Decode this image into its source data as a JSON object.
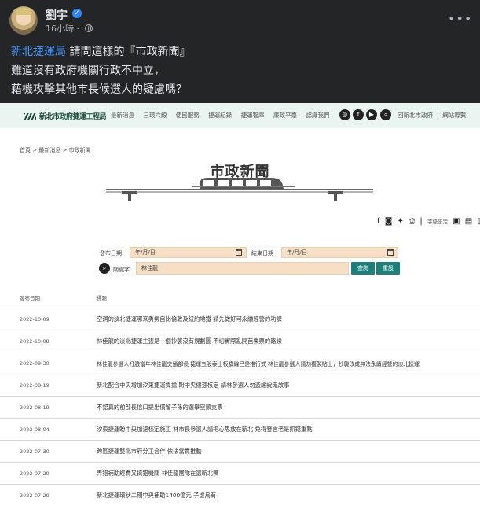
{
  "post": {
    "author": "劉宇",
    "time": "16小時",
    "mention": "新北捷運局",
    "line1_rest": " 請問這樣的『市政新聞』",
    "line2": "難道沒有政府機關行政不中立，",
    "line3": "藉機攻擊其他市長候選人的疑慮嗎？"
  },
  "site": {
    "logo_text": "新北市政府捷運工程局",
    "nav_items": [
      "最新消息",
      "三環六線",
      "便民服務",
      "捷運紀錄",
      "捷運智庫",
      "廉政平臺",
      "認識我們"
    ],
    "nav_right": "回新北市政府 ｜ 網站導覽",
    "breadcrumb": "首頁  >  最新消息  >  市政新聞",
    "page_title": "市政新聞",
    "font_setting_label": "字級設定"
  },
  "filter": {
    "date_label": "發布日期",
    "end_date_label": "結束日期",
    "date_placeholder": "年/月/日",
    "keyword_label": "關鍵字",
    "keyword_value": "林佳龍",
    "search_button": "查詢",
    "reset_button": "重設"
  },
  "table": {
    "headers": {
      "date": "發布日期",
      "title": "標題"
    },
    "rows": [
      {
        "date": "2022-10-09",
        "title": "空洞的淡北捷運哪來勇氣自比倫敦及紐約地鐵 請先做好可永續經營的功課"
      },
      {
        "date": "2022-10-08",
        "title": "林佳龍的淡北捷運主張是一個抄襲沒有規劃圖 不切實際亂開芭樂票的路線"
      },
      {
        "date": "2022-09-30",
        "title": "林佳龍參選人打臉當年林佳龍交通部長 捷運五股泰山板橋線已是推行式 林佳龍參選人請勿複製貼上，抄襲改成無法永續經營的淡北捷運"
      },
      {
        "date": "2022-08-19",
        "title": "新北配合中央增加汐東捷運負擔 盼中央儘速核定 請林參選人勿造謠說鬼故事"
      },
      {
        "date": "2022-08-19",
        "title": "不認真的前部長信口提出債留子孫的選舉空頭支票"
      },
      {
        "date": "2022-08-04",
        "title": "汐東捷運盼中央加速核定施工 林市長參選人請把心思放在新北 免得發言老是抓錯重點"
      },
      {
        "date": "2022-07-30",
        "title": "跨區捷運雙北市府分工合作 依法當責推動"
      },
      {
        "date": "2022-07-29",
        "title": "弄錯補助經費又搞錯機關 林佳龍團隊在選新北嗎"
      },
      {
        "date": "2022-07-29",
        "title": "新北捷運環狀二期中央補助1400億元 子虛烏有"
      }
    ]
  },
  "colors": {
    "fb_bg": "#242526",
    "mention": "#4599ff",
    "nav_bg": "#eaf5f1",
    "input_bg": "#f6dfc4",
    "button": "#1d7f7a"
  }
}
